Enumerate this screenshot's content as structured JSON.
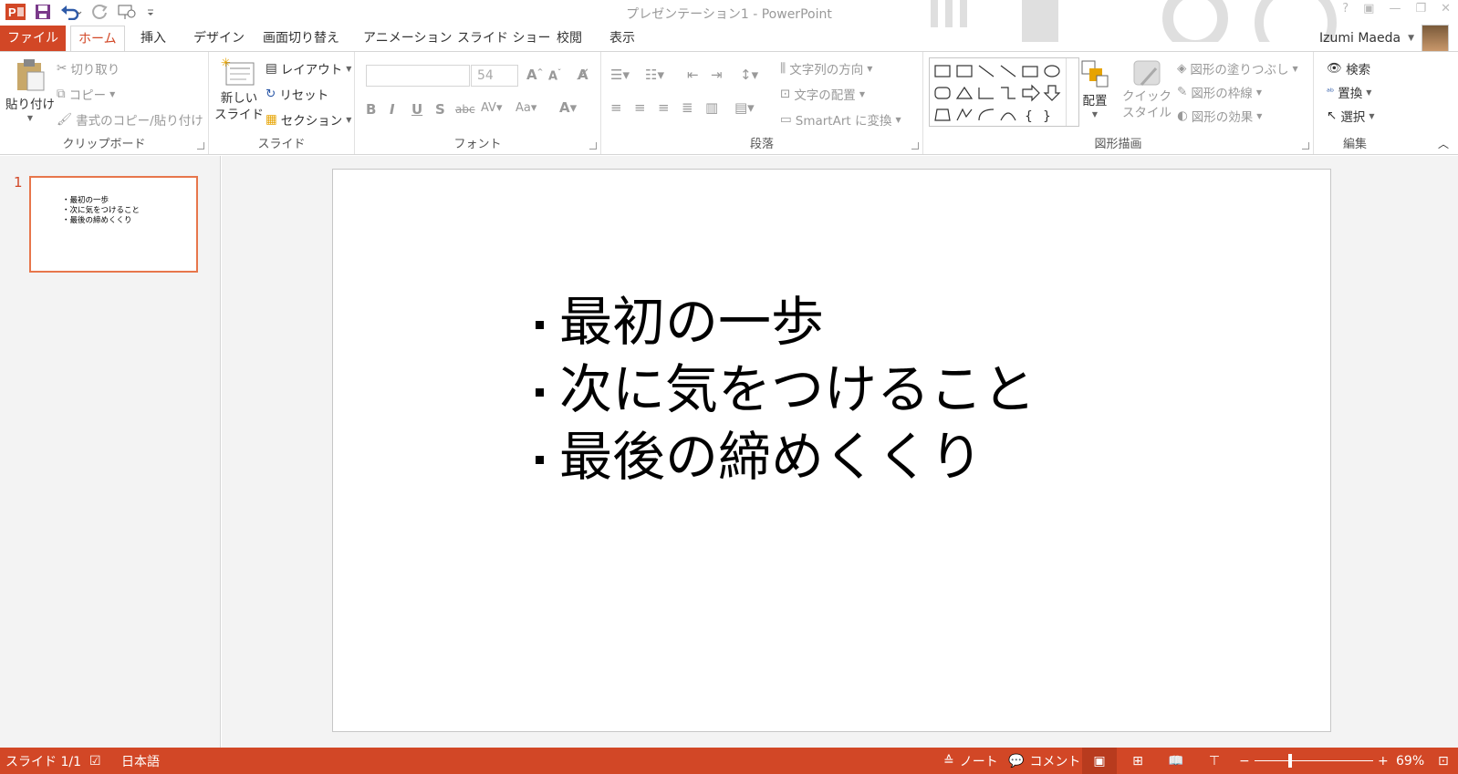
{
  "window": {
    "title": "プレゼンテーション1 - PowerPoint"
  },
  "tabs": [
    {
      "label": "ファイル"
    },
    {
      "label": "ホーム"
    },
    {
      "label": "挿入"
    },
    {
      "label": "デザイン"
    },
    {
      "label": "画面切り替え"
    },
    {
      "label": "アニメーション"
    },
    {
      "label": "スライド ショー"
    },
    {
      "label": "校閲"
    },
    {
      "label": "表示"
    }
  ],
  "user": {
    "name": "Izumi Maeda"
  },
  "ribbon": {
    "clipboard": {
      "paste": "貼り付け",
      "cut": "切り取り",
      "copy": "コピー",
      "format_painter": "書式のコピー/貼り付け",
      "label": "クリップボード"
    },
    "slides": {
      "new_slide_line1": "新しい",
      "new_slide_line2": "スライド",
      "layout": "レイアウト",
      "reset": "リセット",
      "section": "セクション",
      "label": "スライド"
    },
    "font": {
      "font_name": "",
      "font_size": "54",
      "label": "フォント"
    },
    "paragraph": {
      "text_direction": "文字列の方向",
      "align_text": "文字の配置",
      "smartart": "SmartArt に変換",
      "label": "段落"
    },
    "drawing": {
      "arrange": "配置",
      "quick_styles_line1": "クイック",
      "quick_styles_line2": "スタイル",
      "shape_fill": "図形の塗りつぶし",
      "shape_outline": "図形の枠線",
      "shape_effects": "図形の効果",
      "label": "図形描画"
    },
    "editing": {
      "find": "検索",
      "replace": "置換",
      "select": "選択",
      "label": "編集"
    }
  },
  "thumbnails": [
    {
      "number": "1",
      "lines": [
        "・最初の一歩",
        "・次に気をつけること",
        "・最後の締めくくり"
      ]
    }
  ],
  "slide": {
    "bullets": [
      "最初の一歩",
      "次に気をつけること",
      "最後の締めくくり"
    ]
  },
  "status": {
    "slide_counter": "スライド 1/1",
    "language": "日本語",
    "notes": "ノート",
    "comments": "コメント",
    "zoom": "69%"
  },
  "colors": {
    "accent": "#d24726",
    "thumb_border": "#e7764b"
  }
}
